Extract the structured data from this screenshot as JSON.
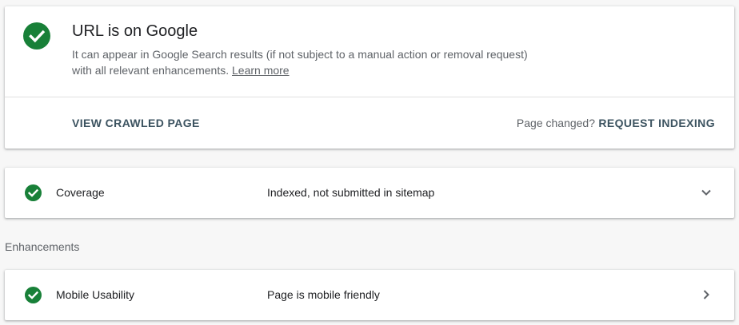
{
  "status": {
    "title": "URL is on Google",
    "description": "It can appear in Google Search results (if not subject to a manual action or removal request) with all relevant enhancements.",
    "learn_more": "Learn more",
    "icon": "check-circle-icon",
    "color": "#188038"
  },
  "actions": {
    "view_crawled_page": "VIEW CRAWLED PAGE",
    "page_changed": "Page changed?",
    "request_indexing": "REQUEST INDEXING"
  },
  "coverage": {
    "label": "Coverage",
    "value": "Indexed, not submitted in sitemap",
    "icon": "check-circle-icon",
    "chevron": "chevron-down-icon"
  },
  "enhancements": {
    "heading": "Enhancements",
    "items": [
      {
        "label": "Mobile Usability",
        "value": "Page is mobile friendly",
        "icon": "check-circle-icon",
        "chevron": "chevron-right-icon"
      }
    ]
  }
}
